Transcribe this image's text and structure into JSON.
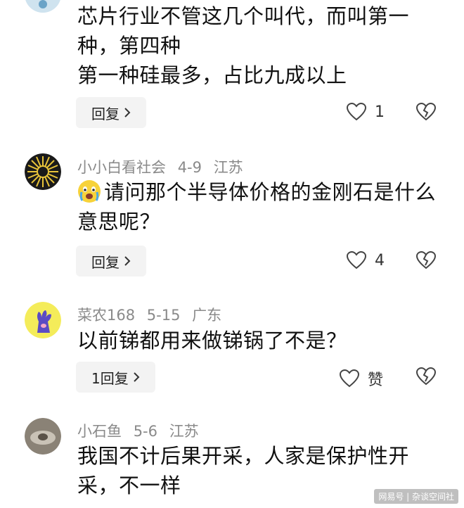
{
  "comments": [
    {
      "username": "",
      "date": "",
      "location": "",
      "lines": [
        "芯片行业不管这几个叫代，而叫第一",
        "种，第四种",
        "第一种硅最多，占比九成以上"
      ],
      "reply_label": "回复",
      "like_count": "1"
    },
    {
      "username": "小小白看社会",
      "date": "4-9",
      "location": "江苏",
      "lines": [
        "请问那个半导体价格的金刚石是什么",
        "意思呢？"
      ],
      "reply_label": "回复",
      "like_count": "4",
      "emoji_icon": "crying-face-emoji"
    },
    {
      "username": "菜农168",
      "date": "5-15",
      "location": "广东",
      "lines": [
        "以前锑都用来做锑锅了不是？"
      ],
      "reply_label": "1回复",
      "like_count": "赞"
    },
    {
      "username": "小石鱼",
      "date": "5-6",
      "location": "江苏",
      "lines": [
        "我国不计后果开采，人家是保护性开",
        "采，不一样"
      ]
    }
  ],
  "icons": {
    "chevron": "chevron-right-icon",
    "like": "heart-outline-icon",
    "dislike": "broken-heart-icon"
  },
  "watermark": "网易号 | 杂谈空间社",
  "colors": {
    "meta_text": "#8a8a8a",
    "button_bg": "#f3f3f3"
  }
}
